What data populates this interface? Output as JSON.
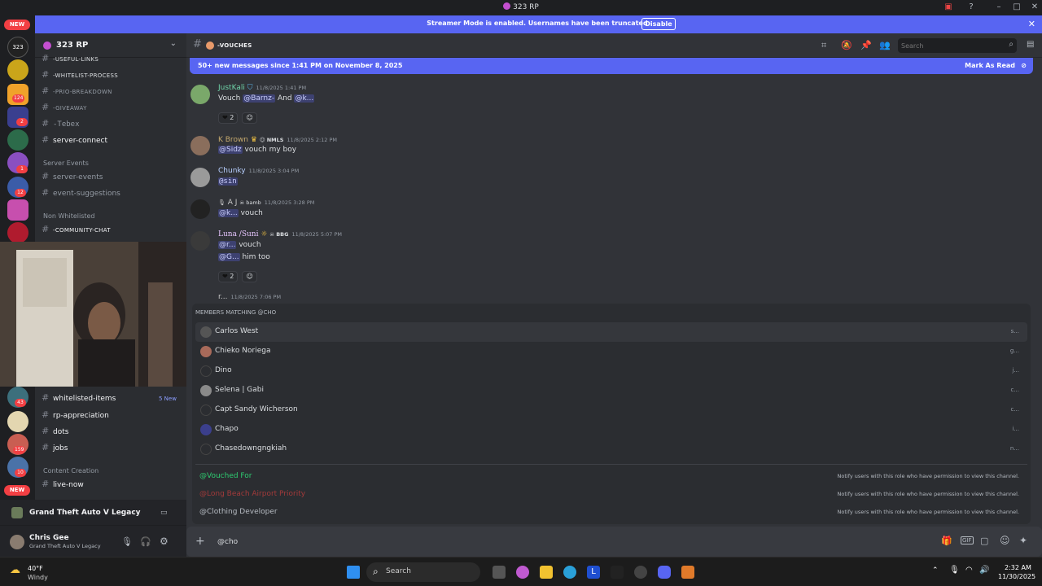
{
  "window": {
    "title": "323 RP"
  },
  "banner": {
    "text": "Streamer Mode is enabled. Usernames have been truncated.",
    "disable": "Disable"
  },
  "servers": {
    "new1": "NEW",
    "new2": "NEW",
    "badges": [
      "124",
      "2",
      "1",
      "12",
      "43",
      "159",
      "10"
    ]
  },
  "sidebar": {
    "server_name": "323 RP",
    "channels": [
      {
        "label": "-useful-links"
      },
      {
        "label": "-whitelist-process"
      },
      {
        "label": "-prio-breakdown"
      },
      {
        "label": "-giveaway"
      },
      {
        "label": "-Tebex"
      },
      {
        "label": "server-connect"
      }
    ],
    "cat_events": "Server Events",
    "events": [
      {
        "label": "server-events"
      },
      {
        "label": "event-suggestions"
      }
    ],
    "cat_nonwl": "Non Whitelisted",
    "community": "-community-chat",
    "lower": [
      {
        "label": "whitelisted-items",
        "badge": "5 New"
      },
      {
        "label": "rp-appreciation"
      },
      {
        "label": "dots"
      },
      {
        "label": "jobs"
      }
    ],
    "cat_content": "Content Creation",
    "live": "live-now"
  },
  "activity": {
    "game": "Grand Theft Auto V Legacy"
  },
  "user": {
    "name": "Chris Gee",
    "status": "Grand Theft Auto V Legacy"
  },
  "channel": {
    "name": "-vouches",
    "search_placeholder": "Search"
  },
  "newbar": {
    "text": "50+ new messages since 1:41 PM on November 8, 2025",
    "mark": "Mark As Read"
  },
  "messages": [
    {
      "name": "JustKali",
      "time": "11/8/2025 1:41 PM",
      "text": "Vouch",
      "m1": "@Barnz-",
      "and": "And",
      "m2": "@k...",
      "react": "2"
    },
    {
      "name": "K Brown",
      "tag": "NMLS",
      "time": "11/8/2025 2:12 PM",
      "m1": "@Sidz",
      "text": "vouch my boy"
    },
    {
      "name": "Chunky",
      "time": "11/8/2025 3:04 PM",
      "m1": "@sin"
    },
    {
      "name": "A J",
      "tag": "bamb",
      "time": "11/8/2025 3:28 PM",
      "m1": "@k...",
      "text": "vouch"
    },
    {
      "name": "Luna /Suni",
      "tag": "BBG",
      "time": "11/8/2025 5:07 PM",
      "m1": "@r...",
      "text": "vouch",
      "m2": "@G...",
      "text2": "him too",
      "react": "2"
    },
    {
      "name": "r...",
      "time": "11/8/2025 7:06 PM"
    }
  ],
  "autocomplete": {
    "header": "Members matching @cho",
    "members": [
      {
        "name": "Carlos West",
        "tag": "s..."
      },
      {
        "name": "Chieko Noriega",
        "tag": "g..."
      },
      {
        "name": "Dino",
        "tag": "j..."
      },
      {
        "name": "Selena | Gabi",
        "tag": "c..."
      },
      {
        "name": "Capt Sandy Wicherson",
        "tag": "c..."
      },
      {
        "name": "Chapo",
        "tag": "i..."
      },
      {
        "name": "Chasedowngngkiah",
        "tag": "n..."
      }
    ],
    "roles": [
      {
        "name": "@Vouched For",
        "color": "#2ecc71",
        "desc": "Notify users with this role who have permission to view this channel."
      },
      {
        "name": "@Long Beach Airport Priority",
        "color": "#a33a3a",
        "desc": "Notify users with this role who have permission to view this channel."
      },
      {
        "name": "@Clothing Developer",
        "color": "#b5bac1",
        "desc": "Notify users with this role who have permission to view this channel."
      }
    ]
  },
  "composer": {
    "value": "@cho"
  },
  "taskbar": {
    "weather_temp": "40°F",
    "weather_desc": "Windy",
    "search": "Search",
    "time": "2:32 AM",
    "date": "11/30/2025"
  }
}
